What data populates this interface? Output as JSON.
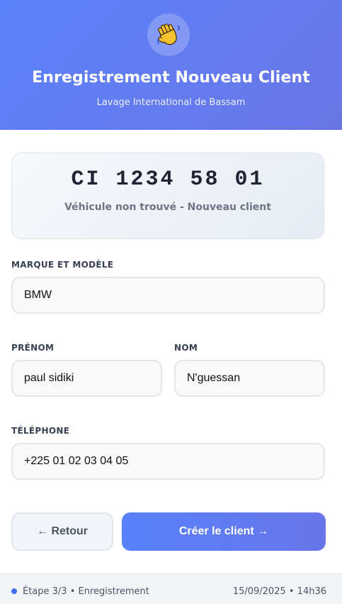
{
  "header": {
    "icon": "waving-hand-icon",
    "title": "Enregistrement Nouveau Client",
    "subtitle": "Lavage International de Bassam"
  },
  "plate": {
    "number": "CI 1234 58 01",
    "status": "Véhicule non trouvé - Nouveau client"
  },
  "form": {
    "brand_label": "MARQUE ET MODÈLE",
    "brand_value": "BMW",
    "firstname_label": "PRÉNOM",
    "firstname_value": "paul sidiki",
    "lastname_label": "NOM",
    "lastname_value": "N'guessan",
    "phone_label": "TÉLÉPHONE",
    "phone_value": "+225 01 02 03 04 05"
  },
  "actions": {
    "back_label": "← Retour",
    "create_label": "Créer le client →"
  },
  "footer": {
    "step": "Étape 3/3 • Enregistrement",
    "datetime": "15/09/2025 • 14h36"
  },
  "colors": {
    "accent": "#5b82fb",
    "accent_end": "#6a76e6",
    "footer_dot": "#3f6ff0"
  }
}
